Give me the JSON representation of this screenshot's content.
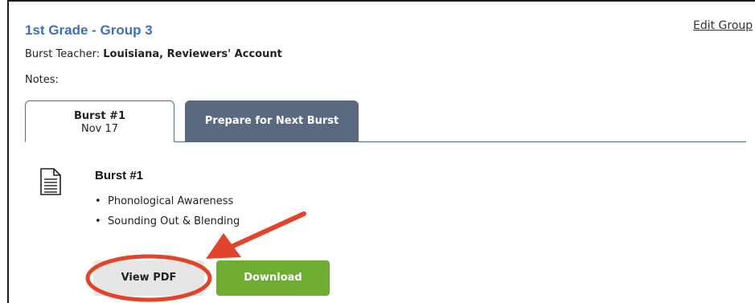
{
  "group": {
    "title": "1st Grade - Group 3",
    "edit_link": "Edit Group",
    "teacher_label": "Burst Teacher:",
    "teacher_name": "Louisiana, Reviewers' Account",
    "notes_label": "Notes:"
  },
  "tabs": [
    {
      "label": "Burst #1",
      "sublabel": "Nov 17",
      "active": true
    },
    {
      "label": "Prepare for Next Burst",
      "active": false
    }
  ],
  "burst": {
    "icon": "document-icon",
    "title": "Burst #1",
    "skills": [
      "Phonological Awareness",
      "Sounding Out & Blending"
    ]
  },
  "actions": {
    "view_pdf_label": "View PDF",
    "download_label": "Download"
  },
  "colors": {
    "title_blue": "#3f6fb5",
    "tab_inactive_bg": "#5a6880",
    "download_green": "#6fac32",
    "view_pdf_bg": "#e6e6e6",
    "annotation_red": "#e0452b"
  }
}
